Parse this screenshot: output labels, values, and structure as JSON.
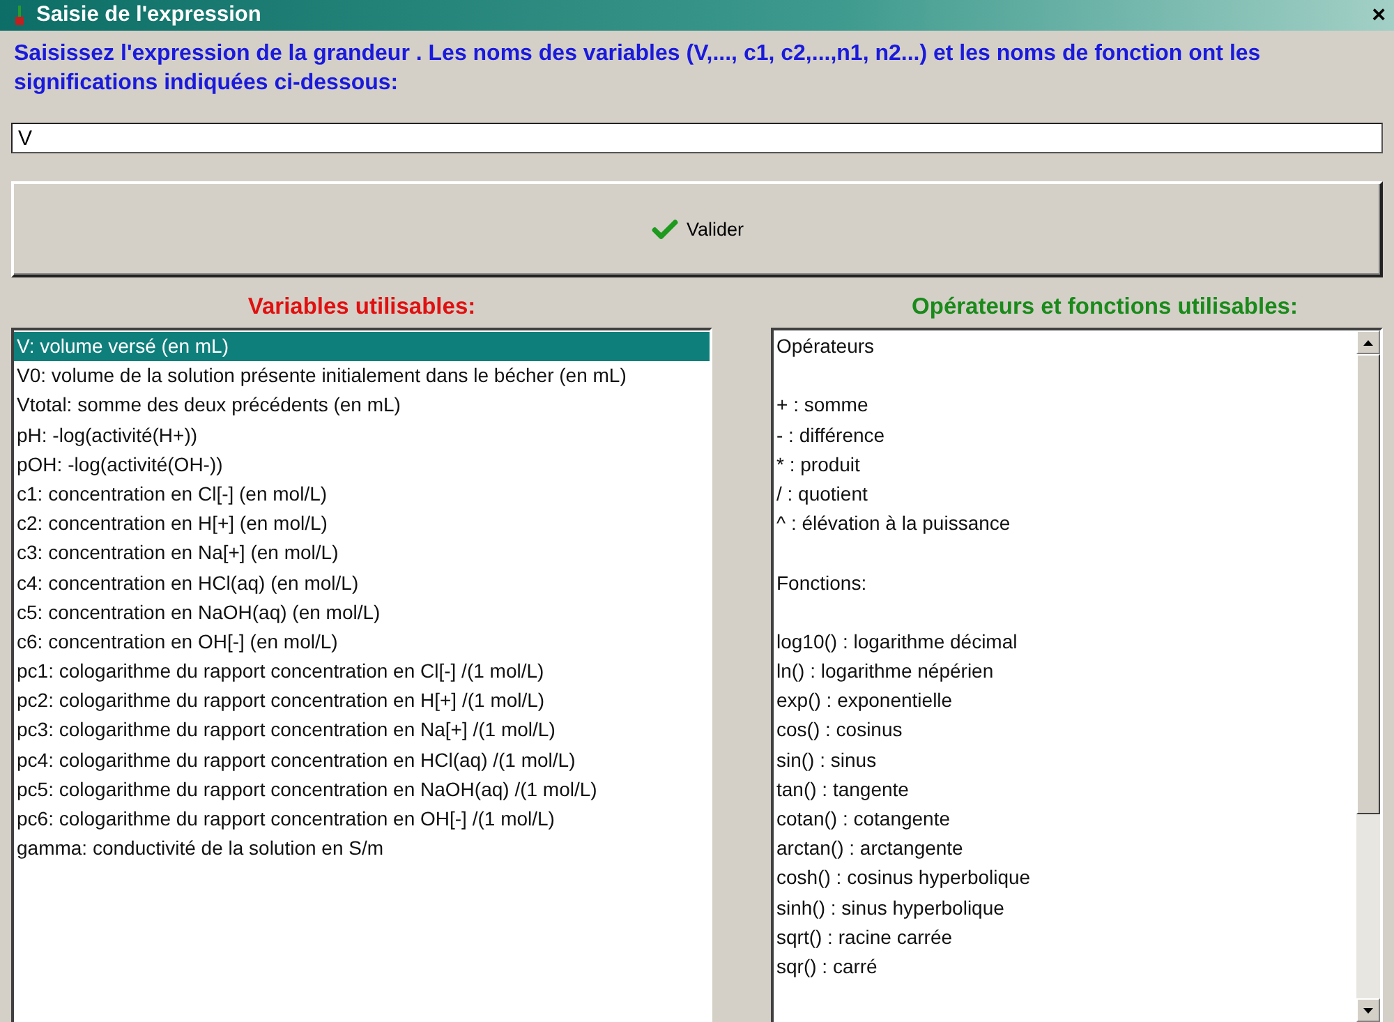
{
  "window": {
    "title": "Saisie de l'expression",
    "close": "×"
  },
  "instruction": "Saisissez l'expression de la grandeur . Les noms des variables (V,..., c1, c2,...,n1, n2...) et les noms de fonction ont les significations indiquées ci-dessous:",
  "expression": {
    "value": "V"
  },
  "validate_button": {
    "label": "Valider"
  },
  "variables": {
    "heading": "Variables utilisables:",
    "items": [
      {
        "label": "V: volume versé (en mL)",
        "selected": true
      },
      {
        "label": "V0: volume de la solution présente initialement dans le bécher (en mL)",
        "selected": false
      },
      {
        "label": "Vtotal: somme des deux précédents (en mL)",
        "selected": false
      },
      {
        "label": "pH: -log(activité(H+))",
        "selected": false
      },
      {
        "label": "pOH: -log(activité(OH-))",
        "selected": false
      },
      {
        "label": "c1: concentration en Cl[-] (en mol/L)",
        "selected": false
      },
      {
        "label": "c2: concentration en H[+] (en mol/L)",
        "selected": false
      },
      {
        "label": "c3: concentration en Na[+] (en mol/L)",
        "selected": false
      },
      {
        "label": "c4: concentration en HCl(aq) (en mol/L)",
        "selected": false
      },
      {
        "label": "c5: concentration en NaOH(aq) (en mol/L)",
        "selected": false
      },
      {
        "label": "c6: concentration en OH[-] (en mol/L)",
        "selected": false
      },
      {
        "label": "pc1: cologarithme du rapport concentration en Cl[-] /(1 mol/L)",
        "selected": false
      },
      {
        "label": "pc2: cologarithme du rapport concentration en H[+] /(1 mol/L)",
        "selected": false
      },
      {
        "label": "pc3: cologarithme du rapport concentration en Na[+] /(1 mol/L)",
        "selected": false
      },
      {
        "label": "pc4: cologarithme du rapport concentration en HCl(aq) /(1 mol/L)",
        "selected": false
      },
      {
        "label": "pc5: cologarithme du rapport concentration en NaOH(aq) /(1 mol/L)",
        "selected": false
      },
      {
        "label": "pc6: cologarithme du rapport concentration en OH[-] /(1 mol/L)",
        "selected": false
      },
      {
        "label": "gamma: conductivité de la solution en S/m",
        "selected": false
      }
    ]
  },
  "operators": {
    "heading": "Opérateurs et fonctions utilisables:",
    "sections": [
      {
        "title": "Opérateurs",
        "items": [
          "+ : somme",
          "- : différence",
          "* : produit",
          "/ : quotient",
          "^ : élévation à la puissance"
        ]
      },
      {
        "title": "Fonctions:",
        "items": [
          "log10() : logarithme décimal",
          "ln() : logarithme népérien",
          "exp() : exponentielle",
          "cos() : cosinus",
          "sin() : sinus",
          "tan() : tangente",
          "cotan() : cotangente",
          "arctan() : arctangente",
          "cosh() : cosinus hyperbolique",
          "sinh() : sinus hyperbolique",
          "sqrt() : racine carrée",
          "sqr() : carré"
        ]
      }
    ]
  }
}
